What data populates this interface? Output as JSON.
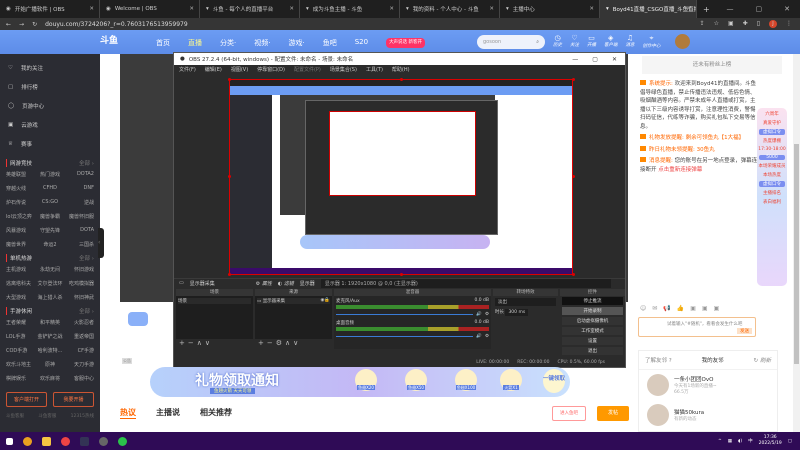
{
  "browser": {
    "tabs": [
      {
        "title": "开始广播软件 | OBS"
      },
      {
        "title": "Welcome | OBS"
      },
      {
        "title": "斗鱼 - 每个人的直播平台"
      },
      {
        "title": "成为斗鱼主播 - 斗鱼"
      },
      {
        "title": "我的资料 - 个人中心 - 斗鱼"
      },
      {
        "title": "主播中心"
      },
      {
        "title": "Boyd41直播_CSGO直播_斗鱼直播",
        "active": true
      }
    ],
    "new_tab": "+",
    "url": "douyu.com/3724206?_r=0.7603176513959979",
    "user_badge": "J"
  },
  "header": {
    "logo": "斗鱼",
    "nav": [
      "首页",
      "直播",
      "分类·",
      "视频·",
      "游戏·",
      "鱼吧",
      "S20"
    ],
    "active_nav": "直播",
    "promo": "大声说话 新客开",
    "search_placeholder": "gosoon",
    "icons": [
      {
        "label": "历史",
        "icon": "history-icon",
        "glyph": "◷"
      },
      {
        "label": "关注",
        "icon": "heart-icon",
        "glyph": "♡"
      },
      {
        "label": "开播",
        "icon": "broadcast-icon",
        "glyph": "▭"
      },
      {
        "label": "客户端",
        "icon": "client-icon",
        "glyph": "◈"
      },
      {
        "label": "消息",
        "icon": "bell-icon",
        "glyph": "♫"
      },
      {
        "label": "创作中心",
        "icon": "location-icon",
        "glyph": "⌖"
      }
    ]
  },
  "sidebar": {
    "items": [
      {
        "label": "我的关注",
        "glyph": "♡"
      },
      {
        "label": "排行榜",
        "glyph": "▢"
      },
      {
        "label": "页游中心",
        "glyph": "◯"
      },
      {
        "label": "云游戏",
        "glyph": "▣"
      },
      {
        "label": "赛事",
        "glyph": "♕"
      }
    ],
    "sections": [
      {
        "title": "网游竞技",
        "all": "全部 ›",
        "games": [
          "英雄联盟",
          "热门游戏",
          "DOTA2",
          "穿越火线",
          "CFHD",
          "DNF",
          "炉石传说",
          "CS:GO",
          "逆战",
          "lol云顶之弈",
          "魔兽争霸",
          "魔兽怀旧服",
          "风暴游戏",
          "守望先锋",
          "DOTA",
          "魔兽世界",
          "命运2",
          "三国杀"
        ]
      },
      {
        "title": "单机热游",
        "all": "全部 ›",
        "games": [
          "主机游戏",
          "永劫无间",
          "怀旧游戏",
          "逃离塔科夫",
          "艾尔登法环",
          "吃鸡模拟器",
          "大型游戏",
          "海上猎人杀",
          "怀旧神武"
        ]
      },
      {
        "title": "手游休闲",
        "all": "全部 ›",
        "games": [
          "王者荣耀",
          "和平精英",
          "火影忍者",
          "LOL手游",
          "金铲铲之战",
          "重返帝国",
          "COD手游",
          "哈利波特...",
          "CF手游",
          "欢乐斗地主",
          "原神",
          "天刀手游",
          "棋牌娱乐",
          "欢乐麻将",
          "客服中心"
        ]
      }
    ],
    "buttons": [
      "客户端打开",
      "我要开播"
    ],
    "footer": [
      "斗鱼客服",
      "斗鱼客服",
      "12315热线"
    ]
  },
  "obs": {
    "title": "OBS 27.2.4 (64-bit, windows) - 配置文件: 未命名 - 场景: 未命名",
    "menu": [
      "文件(F)",
      "编辑(E)",
      "视图(V)",
      "停靠窗口(D)",
      "配置文件(P)",
      "场景集合(S)",
      "工具(T)",
      "帮助(H)"
    ],
    "source_bar": {
      "source": "显示器采集",
      "properties": "属性",
      "filters": "滤镜",
      "display_label": "显示器",
      "display_value": "显示器 1: 1920x1080 @ 0,0 (主显示器)"
    },
    "docks": {
      "scenes": {
        "title": "场景",
        "items": [
          "场景"
        ]
      },
      "sources": {
        "title": "来源",
        "items": [
          "显示器采集"
        ]
      },
      "mixer": {
        "title": "混音器",
        "channels": [
          {
            "name": "麦克风/Aux",
            "level": "0.0 dB"
          },
          {
            "name": "桌面音频",
            "level": "0.0 dB"
          }
        ]
      },
      "transitions": {
        "title": "转场特效",
        "type": "淡出",
        "duration_label": "时长",
        "duration": "300 ms"
      },
      "controls": {
        "title": "控件",
        "buttons": [
          "停止推流",
          "开始录制",
          "启动虚拟摄像机",
          "工作室模式",
          "设置",
          "退出"
        ]
      }
    },
    "status": {
      "live": "LIVE: 00:00:00",
      "rec": "REC: 00:00:00",
      "cpu": "CPU: 0.5%, 60.00 fps"
    }
  },
  "page": {
    "gift_banner": {
      "title": "礼物领取通知",
      "subtitle": "鱼翅火箭 天天可领",
      "items": [
        "鱼翅X20",
        "鱼翅X50",
        "鱼翅X100",
        "火箭X1"
      ],
      "claim": "一键领取"
    },
    "content_tabs": [
      "热议",
      "主播说",
      "相关推荐"
    ],
    "enter_bar": "进入鱼吧",
    "post": "发帖",
    "tag": "公告"
  },
  "chat": {
    "rank": "还未有粉丝上榜",
    "messages": [
      {
        "tag": "系统提示:",
        "text": "欢迎来到Boyd41的直播间。斗鱼倡导绿色直播，禁止传播违法违规、低俗色情、吸烟酗酒等内容。严禁未成年人直播或打赏，主播以下三级内容诱导打赏，注意理性消费，警惕扫码征信，代练等诈骗，购买礼包私下交易等信息。"
      },
      {
        "tag": "礼物发放提醒:",
        "text": "剩余可领鱼丸【1大福】"
      },
      {
        "tag": "昨日礼物未领提醒:",
        "text": "30鱼丸"
      },
      {
        "tag": "消息提醒:",
        "text": "您的账号在另一地点登录，弹幕连接断开",
        "link": "点击重新连接弹幕"
      }
    ],
    "input_placeholder": "试着输入\"#随机\"，看看会发生什么吧",
    "send": "发送",
    "promo": [
      "六周年",
      "真爱守护",
      "虚拟口令",
      "热度爆棚",
      "17:30-18:00",
      "5000",
      "本场荣耀成员",
      "本场热度",
      "虚拟口令",
      "主播排名",
      "表白福利"
    ],
    "friends": {
      "help": "了解友邻 ?",
      "title": "我的友邻",
      "refresh": "刷新",
      "list": [
        {
          "name": "一条小团团OvO",
          "sub": "今天有1场新的直播~",
          "hot": "66.5万"
        },
        {
          "name": "猫猫50kura",
          "sub": "有新的动态"
        }
      ]
    }
  },
  "taskbar": {
    "time": "17:36",
    "date": "2022/5/19"
  }
}
